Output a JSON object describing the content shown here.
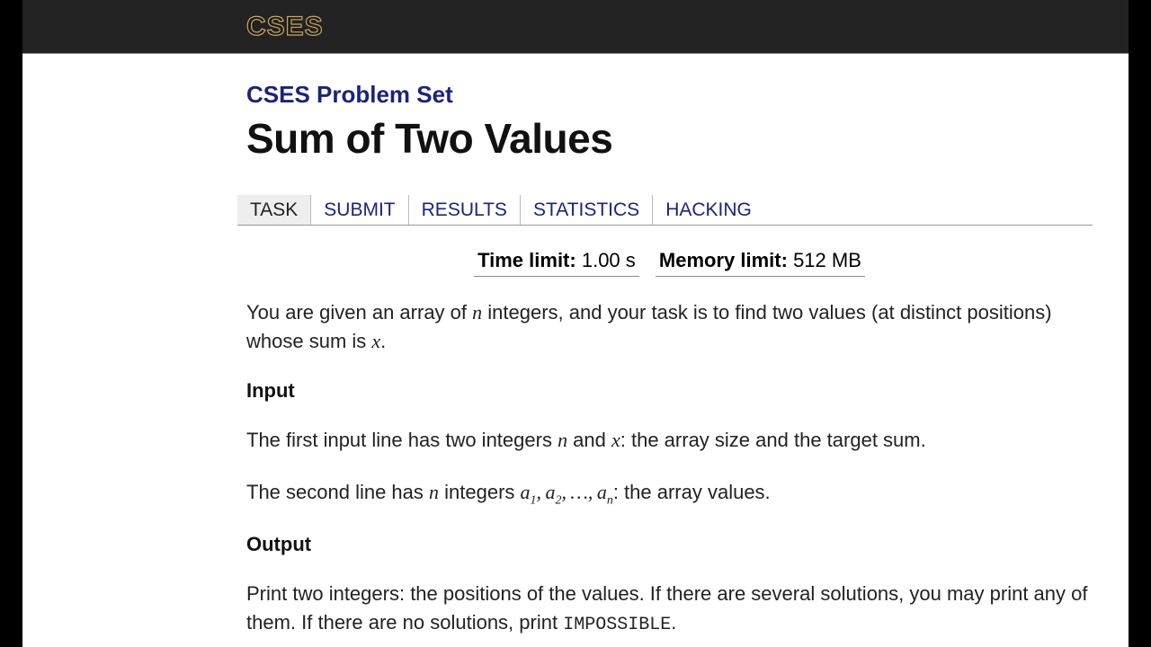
{
  "logo": "CSES",
  "site_title": "CSES Problem Set",
  "problem_title": "Sum of Two Values",
  "tabs": {
    "task": "TASK",
    "submit": "SUBMIT",
    "results": "RESULTS",
    "statistics": "STATISTICS",
    "hacking": "HACKING"
  },
  "limits": {
    "time_label": "Time limit:",
    "time_value": "1.00 s",
    "mem_label": "Memory limit:",
    "mem_value": "512 MB"
  },
  "desc": {
    "p1a": "You are given an array of ",
    "p1b": " integers, and your task is to find two values (at distinct positions) whose sum is ",
    "p1c": ".",
    "input_head": "Input",
    "p2a": "The first input line has two integers ",
    "p2b": " and ",
    "p2c": ": the array size and the target sum.",
    "p3a": "The second line has ",
    "p3b": " integers ",
    "p3c": ": the array values.",
    "output_head": "Output",
    "p4a": "Print two integers: the positions of the values. If there are several solutions, you may print any of them. If there are no solutions, print ",
    "p4b": "IMPOSSIBLE",
    "p4c": "."
  },
  "math": {
    "n": "n",
    "x": "x",
    "a": "a",
    "one": "1",
    "two": "2",
    "comma": ", ",
    "dots": "…",
    "comma2": ", "
  }
}
